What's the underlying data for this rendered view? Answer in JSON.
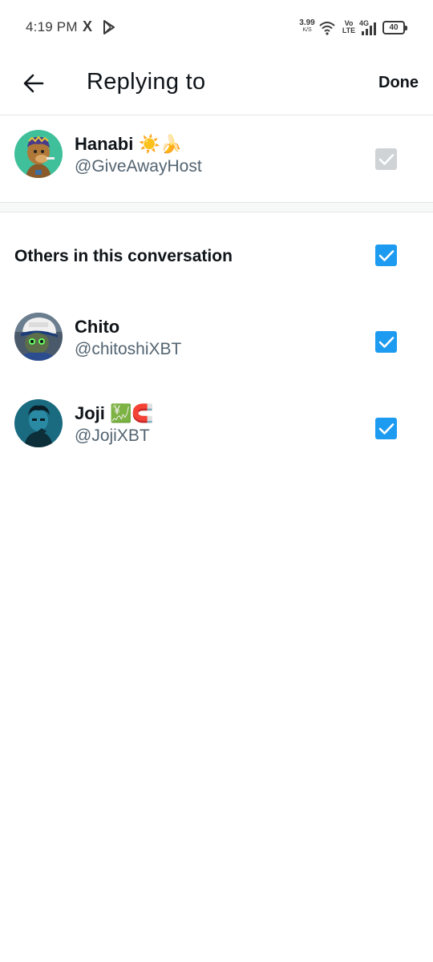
{
  "status_bar": {
    "time": "4:19 PM",
    "x_icon": "X",
    "net_speed": "3.99",
    "net_speed_unit": "K/S",
    "volte_top": "Vo",
    "volte_bottom": "LTE",
    "network": "4G",
    "battery": "40"
  },
  "header": {
    "title": "Replying to",
    "done_label": "Done"
  },
  "primary": {
    "name": "Hanabi",
    "name_emoji": "☀️🍌",
    "handle": "@GiveAwayHost",
    "checked": true,
    "disabled": true
  },
  "others_section": {
    "title": "Others in this conversation",
    "checked": true
  },
  "others": [
    {
      "name": "Chito",
      "name_emoji": "",
      "handle": "@chitoshiXBT",
      "checked": true
    },
    {
      "name": "Joji",
      "name_emoji": "💹🧲",
      "handle": "@JojiXBT",
      "checked": true
    }
  ],
  "colors": {
    "accent": "#1d9bf0",
    "disabled_check": "#cfd3d6",
    "secondary_text": "#536471"
  }
}
